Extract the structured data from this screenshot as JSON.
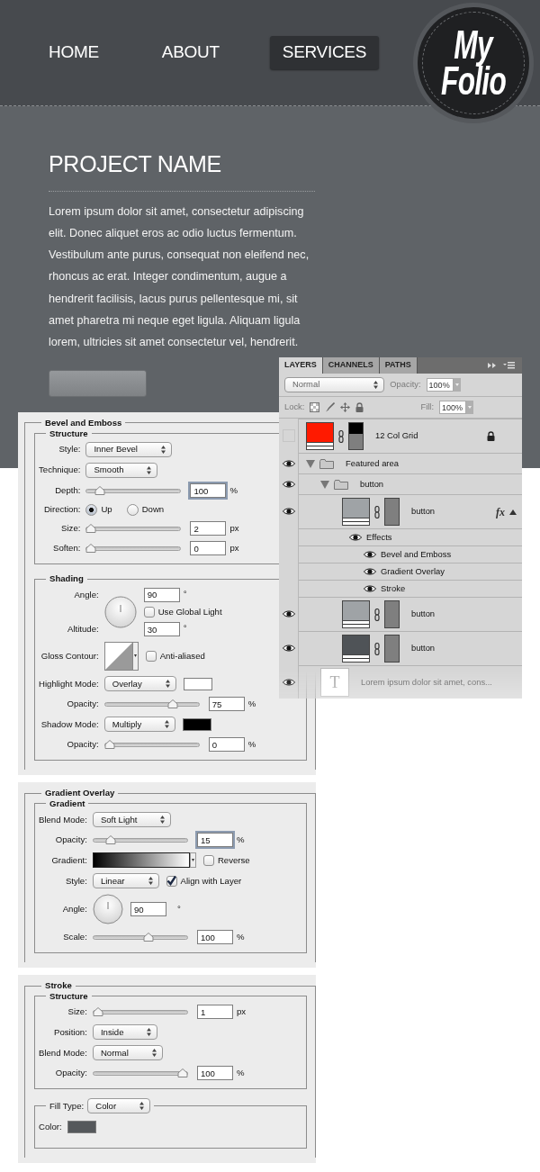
{
  "nav": [
    {
      "label": "HOME",
      "selected": false
    },
    {
      "label": "ABOUT",
      "selected": false
    },
    {
      "label": "SERVICES",
      "selected": true
    }
  ],
  "logo": {
    "line_1": "My",
    "line_2": "Folio"
  },
  "project": {
    "title": "PROJECT NAME",
    "body": "Lorem ipsum dolor sit amet, consectetur adipiscing elit. Donec aliquet eros ac odio luctus fermentum. Vestibulum ante purus, consequat non eleifend nec, rhoncus ac erat. Integer condimentum, augue a hendrerit facilisis, lacus purus pellentesque mi, sit amet pharetra mi neque eget ligula. Aliquam ligula lorem, ultricies sit amet consectetur vel, hendrerit."
  },
  "panels": [
    {
      "title": "Bevel and Emboss",
      "groups": [
        {
          "title": "Structure",
          "rows": [
            {
              "kind": "select",
              "label": "Style:",
              "value": "Inner Bevel"
            },
            {
              "kind": "select",
              "label": "Technique:",
              "value": "Smooth"
            },
            {
              "kind": "slider",
              "label": "Depth:",
              "level": 0.1,
              "value": "100",
              "unit": "%",
              "focused": true
            },
            {
              "kind": "radio",
              "label": "Direction:",
              "options": [
                {
                  "label": "Up",
                  "selected": true
                },
                {
                  "label": "Down",
                  "selected": false
                }
              ]
            },
            {
              "kind": "slider",
              "label": "Size:",
              "level": 0,
              "value": "2",
              "unit": "px",
              "focused": false
            },
            {
              "kind": "slider",
              "label": "Soften:",
              "level": 0,
              "value": "0",
              "unit": "px",
              "focused": false
            }
          ]
        },
        {
          "title": "Shading",
          "rows": [
            {
              "kind": "dial",
              "label": "Angle:",
              "value": "90",
              "unit": "°",
              "checkbox": {
                "label": "Use Global Light",
                "checked": false
              },
              "label_2": "Altitude:",
              "value_2": "30",
              "unit_2": "°"
            },
            {
              "kind": "contour",
              "label": "Gloss Contour:",
              "checkbox": {
                "label": "Anti-aliased",
                "checked": false
              }
            },
            {
              "kind": "select",
              "label": "Highlight Mode:",
              "value": "Overlay",
              "color": "#ffffff"
            },
            {
              "kind": "slider",
              "label": "Opacity:",
              "level": 0.75,
              "value": "75",
              "unit": "%",
              "focused": false
            },
            {
              "kind": "select",
              "label": "Shadow Mode:",
              "value": "Multiply",
              "color": "#000000"
            },
            {
              "kind": "slider",
              "label": "Opacity:",
              "level": 0,
              "value": "0",
              "unit": "%",
              "focused": false
            }
          ]
        }
      ]
    },
    {
      "title": "Gradient Overlay",
      "groups": [
        {
          "title": "Gradient",
          "rows": [
            {
              "kind": "select",
              "label": "Blend Mode:",
              "value": "Soft Light"
            },
            {
              "kind": "slider",
              "label": "Opacity:",
              "level": 0.15,
              "value": "15",
              "unit": "%",
              "focused": true
            },
            {
              "kind": "gradient",
              "label": "Gradient:",
              "checkbox": {
                "label": "Reverse",
                "checked": false
              }
            },
            {
              "kind": "select",
              "label": "Style:",
              "value": "Linear",
              "checkbox": {
                "label": "Align with Layer",
                "checked": true
              }
            },
            {
              "kind": "dial",
              "label": "Angle:",
              "value": "90",
              "unit": "°"
            },
            {
              "kind": "slider",
              "label": "Scale:",
              "level": 0.6,
              "value": "100",
              "unit": "%",
              "focused": false
            }
          ]
        }
      ]
    },
    {
      "title": "Stroke",
      "groups": [
        {
          "title": "Structure",
          "rows": [
            {
              "kind": "slider",
              "label": "Size:",
              "level": 0,
              "value": "1",
              "unit": "px",
              "focused": false
            },
            {
              "kind": "select",
              "label": "Position:",
              "value": "Inside"
            },
            {
              "kind": "select",
              "label": "Blend Mode:",
              "value": "Normal"
            },
            {
              "kind": "slider",
              "label": "Opacity:",
              "level": 1,
              "value": "100",
              "unit": "%",
              "focused": false
            }
          ]
        },
        {
          "title": "Fill Type:",
          "title_select": "Color",
          "rows": [
            {
              "kind": "color",
              "label": "Color:",
              "color": "#55585b"
            }
          ]
        }
      ]
    }
  ],
  "layers_panel": {
    "tabs": [
      {
        "label": "LAYERS",
        "selected": true
      },
      {
        "label": "CHANNELS",
        "selected": false
      },
      {
        "label": "PATHS",
        "selected": false
      }
    ],
    "blend_mode": "Normal",
    "opacity_label": "Opacity:",
    "opacity": "100%",
    "lock_label": "Lock:",
    "fill_label": "Fill:",
    "fill": "100%",
    "layers": [
      {
        "kind": "layer",
        "name": "12 Col Grid",
        "visible": false,
        "color": "#ff1a00",
        "locked": true
      },
      {
        "kind": "group",
        "name": "Featured area",
        "visible": true,
        "expanded": true,
        "children": [
          {
            "kind": "group",
            "name": "button",
            "visible": true,
            "expanded": true,
            "children": [
              {
                "kind": "layer",
                "name": "button",
                "visible": true,
                "color": "#9fa3a6",
                "locked": false,
                "fx_label": "fx",
                "effects_expanded": true,
                "children": [
                  {
                    "kind": "effects",
                    "name": "Effects",
                    "visible": true,
                    "children": [
                      {
                        "kind": "effect",
                        "name": "Bevel and Emboss",
                        "visible": true
                      },
                      {
                        "kind": "effect",
                        "name": "Gradient Overlay",
                        "visible": true
                      },
                      {
                        "kind": "effect",
                        "name": "Stroke",
                        "visible": true
                      }
                    ]
                  }
                ]
              },
              {
                "kind": "layer",
                "name": "button",
                "visible": true,
                "color": "#9fa3a6",
                "locked": false
              },
              {
                "kind": "layer",
                "name": "button",
                "visible": true,
                "color": "#4f5357",
                "locked": false
              }
            ]
          },
          {
            "kind": "text",
            "name": "Lorem ipsum dolor sit amet, cons...",
            "visible": true,
            "thumb_text": "T"
          }
        ]
      }
    ]
  }
}
